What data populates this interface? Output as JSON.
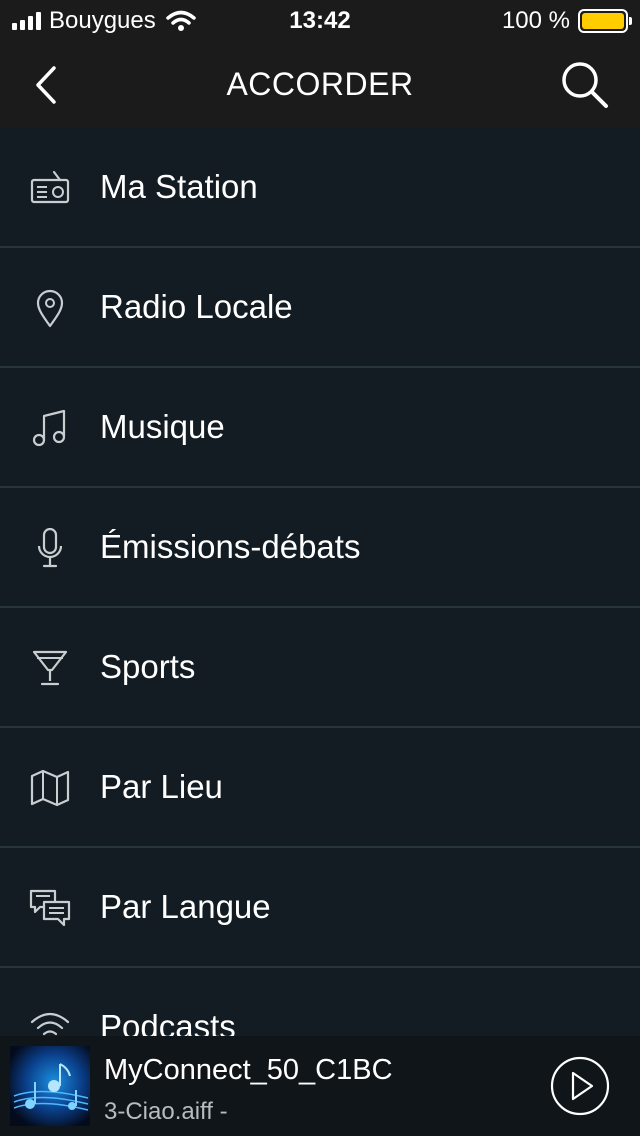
{
  "status_bar": {
    "carrier": "Bouygues",
    "time": "13:42",
    "battery": "100 %",
    "battery_color": "#ffcc00"
  },
  "nav": {
    "title": "ACCORDER",
    "back_icon": "chevron-left-icon",
    "search_icon": "search-icon"
  },
  "menu": {
    "items": [
      {
        "label": "Ma Station",
        "icon": "radio-icon"
      },
      {
        "label": "Radio Locale",
        "icon": "location-pin-icon"
      },
      {
        "label": "Musique",
        "icon": "music-note-icon"
      },
      {
        "label": "Émissions-débats",
        "icon": "microphone-icon"
      },
      {
        "label": "Sports",
        "icon": "trophy-icon"
      },
      {
        "label": "Par Lieu",
        "icon": "map-icon"
      },
      {
        "label": "Par Langue",
        "icon": "speech-bubbles-icon"
      },
      {
        "label": "Podcasts",
        "icon": "podcast-icon"
      }
    ]
  },
  "now_playing": {
    "title": "MyConnect_50_C1BC",
    "subtitle": "3-Ciao.aiff -",
    "play_icon": "play-icon"
  },
  "colors": {
    "background": "#131c22",
    "bar": "#1b1b1b",
    "divider": "#26343d"
  }
}
